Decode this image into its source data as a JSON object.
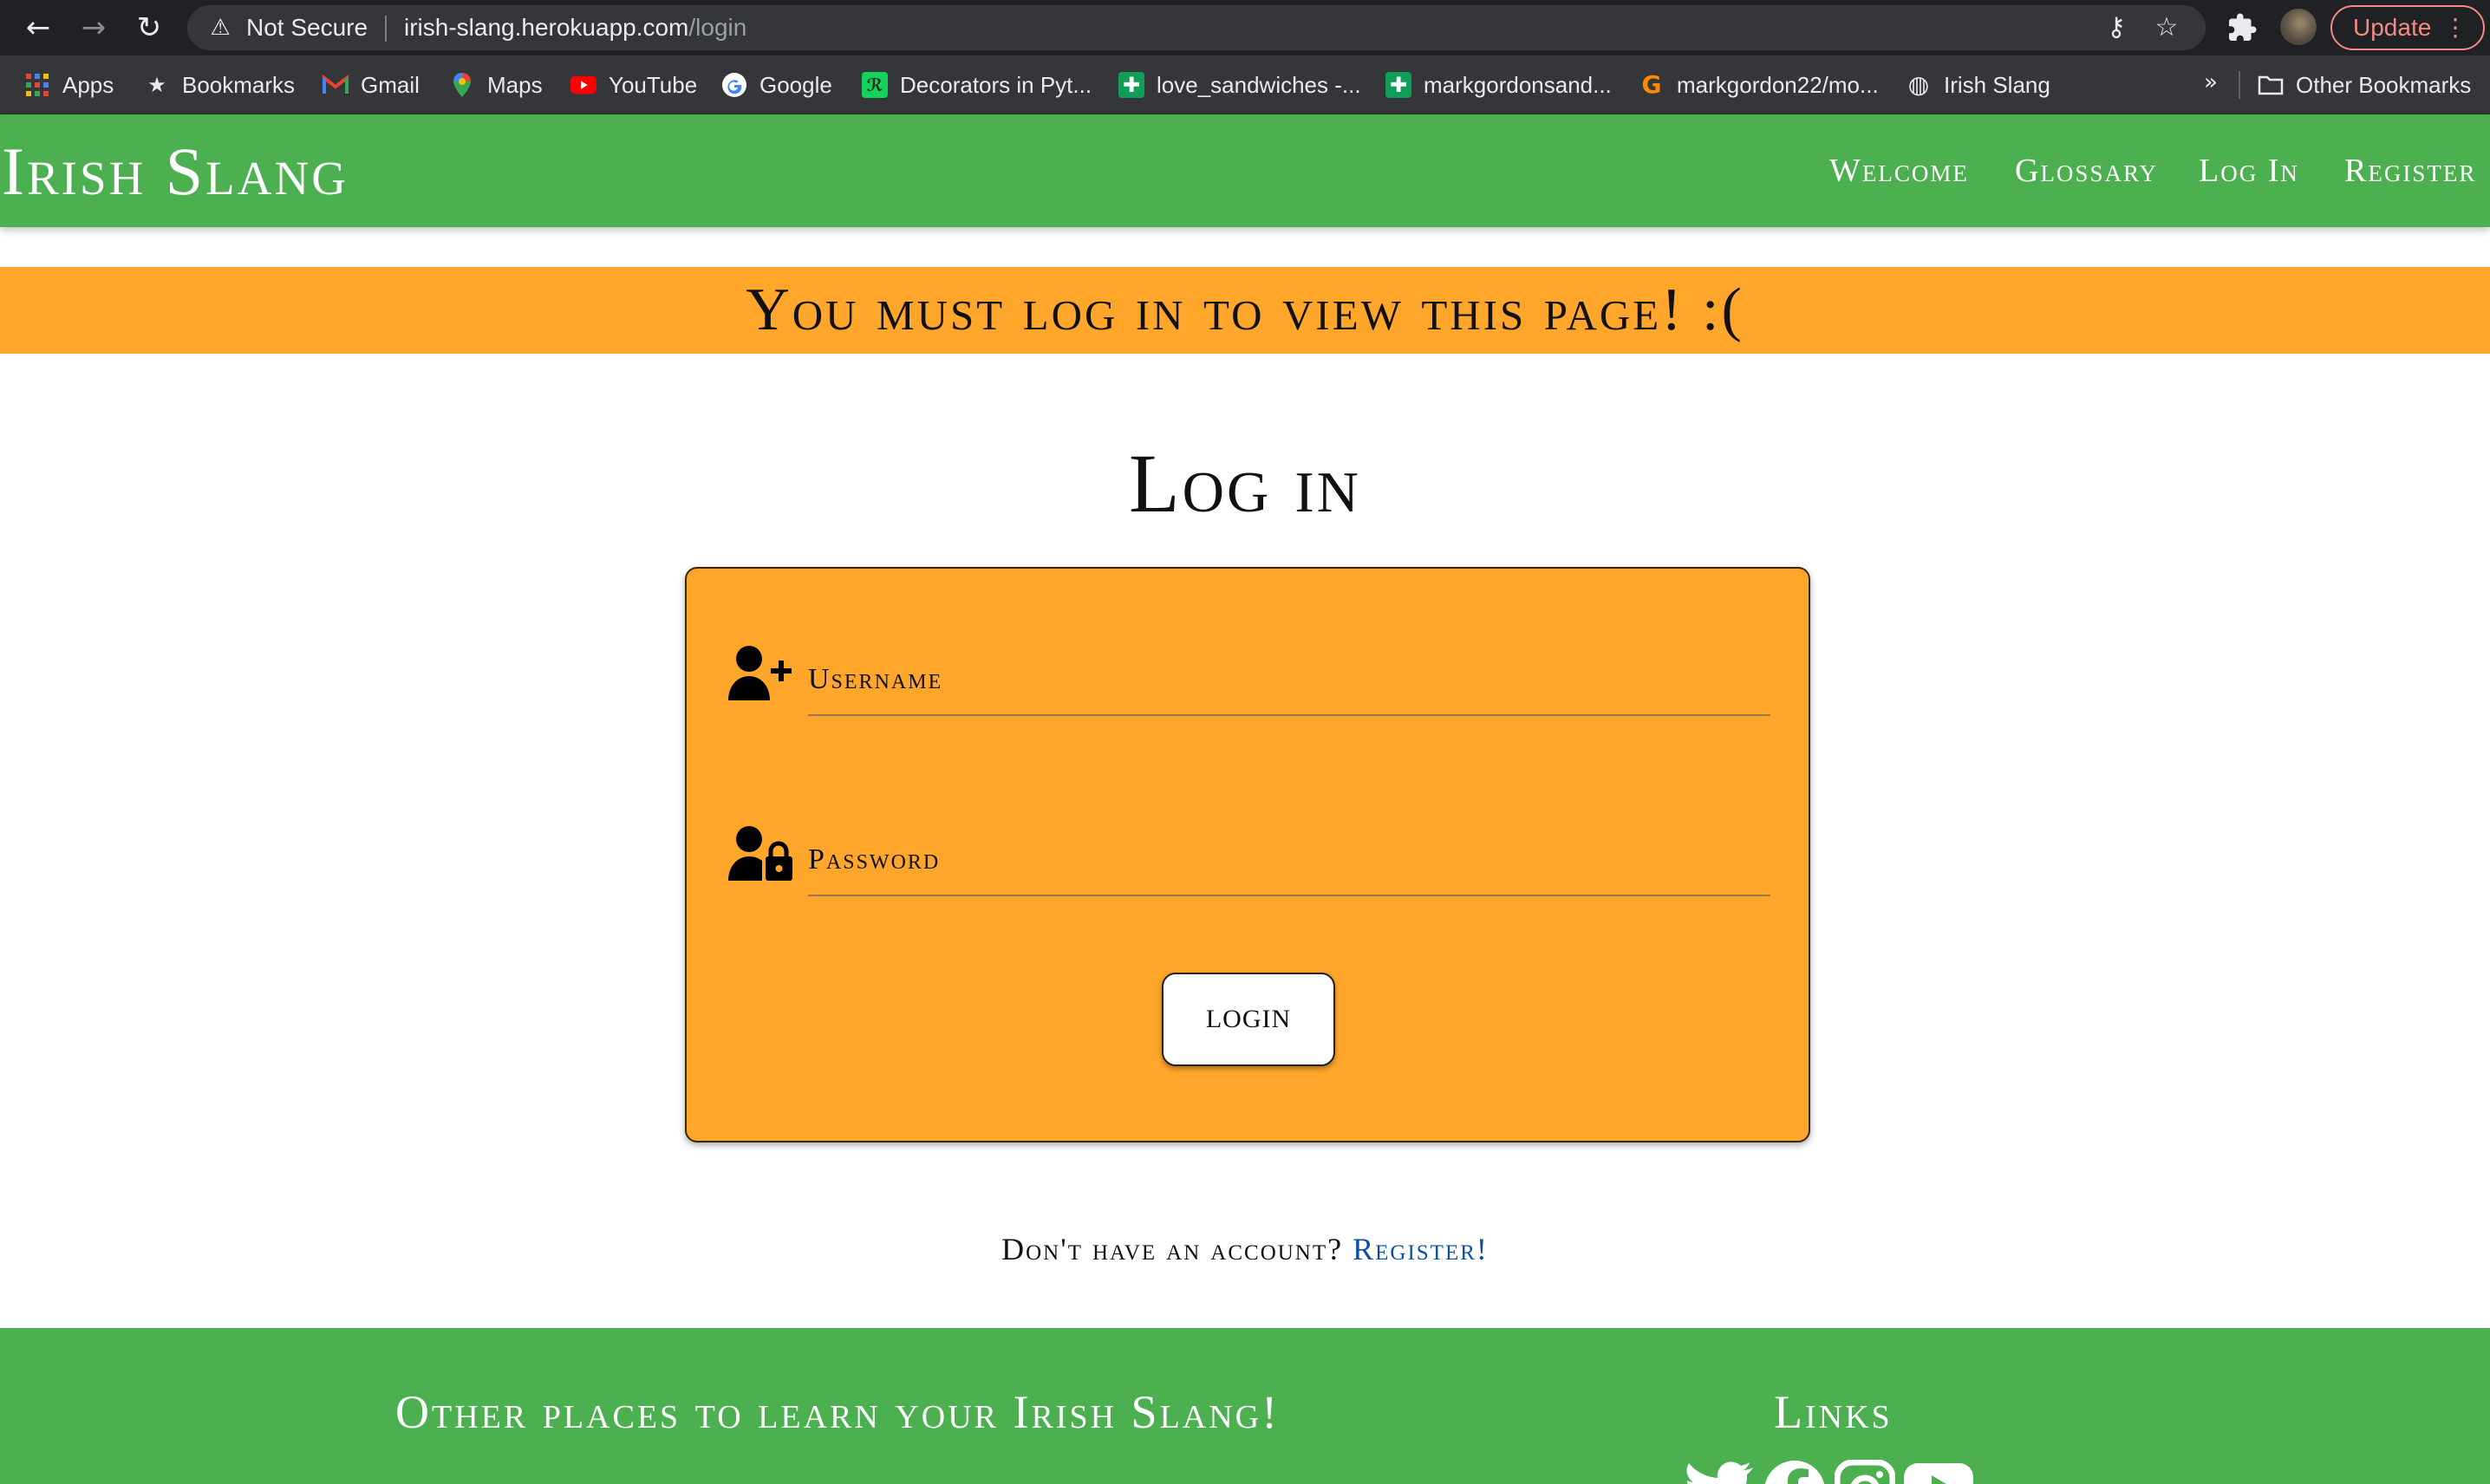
{
  "browser": {
    "security_label": "Not Secure",
    "url_host": "irish-slang.herokuapp.com",
    "url_path": "/login",
    "update_label": "Update",
    "bookmarks": [
      {
        "label": "Apps",
        "icon": "apps-grid-icon"
      },
      {
        "label": "Bookmarks",
        "icon": "star-icon"
      },
      {
        "label": "Gmail",
        "icon": "gmail-icon"
      },
      {
        "label": "Maps",
        "icon": "maps-pin-icon"
      },
      {
        "label": "YouTube",
        "icon": "youtube-icon"
      },
      {
        "label": "Google",
        "icon": "google-icon"
      },
      {
        "label": "Decorators in Pyt...",
        "icon": "decorators-icon"
      },
      {
        "label": "love_sandwiches -...",
        "icon": "sheets-icon"
      },
      {
        "label": "markgordonsand...",
        "icon": "sheets-icon"
      },
      {
        "label": "markgordon22/mo...",
        "icon": "gitpod-icon"
      },
      {
        "label": "Irish Slang",
        "icon": "globe-icon"
      }
    ],
    "more_label": "»",
    "other_bookmarks_label": "Other Bookmarks"
  },
  "site": {
    "brand": "Irish Slang",
    "nav": [
      "Welcome",
      "Glossary",
      "Log In",
      "Register"
    ],
    "accent_color": "#4caf50",
    "form_color": "#ffa62b"
  },
  "flash": {
    "message": "You must log in to view this page! :("
  },
  "login": {
    "title": "Log in",
    "username_label": "Username",
    "password_label": "Password",
    "button_label": "LOGIN"
  },
  "register_prompt": {
    "text": "Don't have an account?",
    "link": "Register!"
  },
  "footer": {
    "left_heading": "Other places to learn your Irish Slang!",
    "right_heading": "Links",
    "social_icons": [
      "twitter-icon",
      "facebook-icon",
      "instagram-icon",
      "youtube-icon"
    ]
  }
}
